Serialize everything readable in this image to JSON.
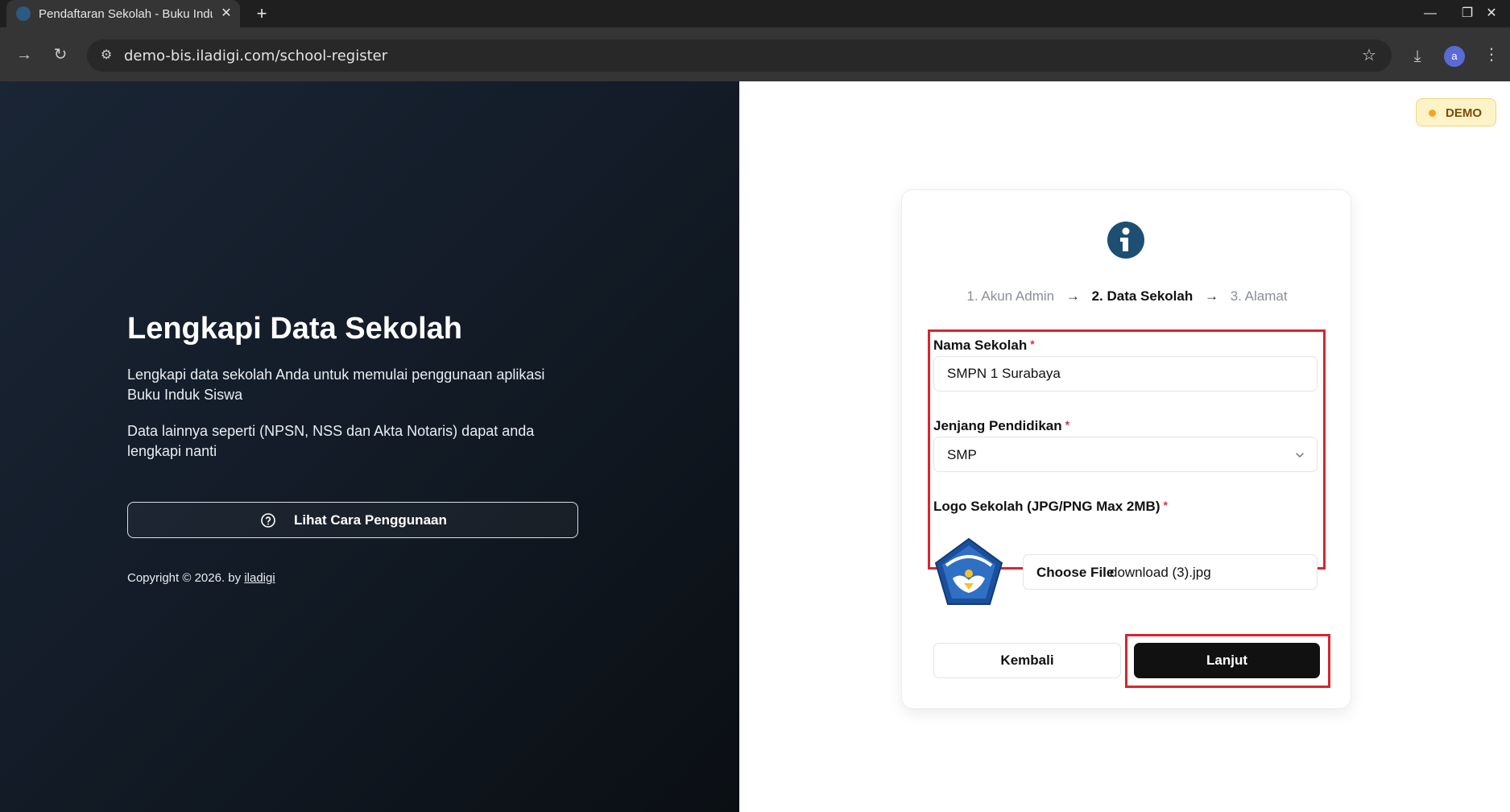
{
  "browser": {
    "tab_title": "Pendaftaran Sekolah - Buku Induk Siswa",
    "url": "demo-bis.iladigi.com/school-register",
    "profile_initial": "a"
  },
  "left": {
    "title": "Lengkapi Data Sekolah",
    "description_1": "Lengkapi data sekolah Anda untuk memulai penggunaan aplikasi Buku Induk Siswa",
    "description_2": "Data lainnya seperti (NPSN, NSS dan Akta Notaris) dapat anda lengkapi nanti",
    "help_button": "Lihat Cara Penggunaan",
    "copyright_prefix": "Copyright © 2026. by",
    "copyright_link": "iladigi"
  },
  "badge": {
    "label": "DEMO"
  },
  "steps": {
    "step1": "1. Akun Admin",
    "step2": "2. Data Sekolah",
    "step3": "3. Alamat",
    "arrow": "→"
  },
  "form": {
    "school_name": {
      "label": "Nama Sekolah",
      "value": "SMPN 1 Surabaya"
    },
    "level": {
      "label": "Jenjang Pendidikan",
      "value": "SMP"
    },
    "logo": {
      "label": "Logo Sekolah (JPG/PNG Max 2MB)",
      "button": "Choose File",
      "file_name": "download (3).jpg"
    },
    "required_mark": "*",
    "back_button": "Kembali",
    "next_button": "Lanjut"
  },
  "colors": {
    "primary": "#111111",
    "highlight": "#d9252f",
    "brand_blue": "#1e4f72",
    "demo_badge_bg": "#fdf3c7"
  }
}
